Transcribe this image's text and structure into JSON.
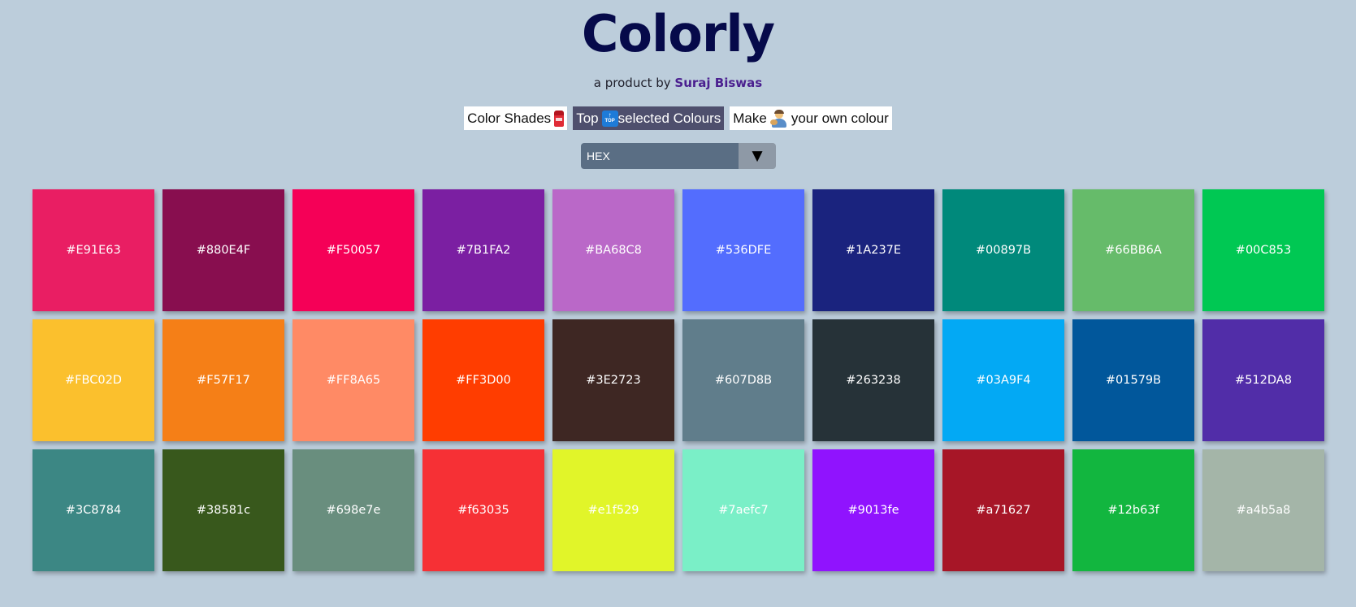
{
  "header": {
    "title": "Colorly",
    "byline_prefix": "a product by",
    "author": "Suraj Biswas"
  },
  "nav": {
    "items": [
      {
        "label": "Color Shades",
        "icon": "crayon-icon",
        "active": false
      },
      {
        "label_before": "Top",
        "icon": "top-icon",
        "label_after": "selected Colours",
        "active": true
      },
      {
        "label_before": "Make",
        "icon": "artist-icon",
        "label_after": "your own colour",
        "active": false
      }
    ]
  },
  "format_select": {
    "value": "HEX",
    "arrow": "▼"
  },
  "colors": {
    "accent": "#060a4a",
    "background": "#bccddb",
    "swatches": [
      "#E91E63",
      "#880E4F",
      "#F50057",
      "#7B1FA2",
      "#BA68C8",
      "#536DFE",
      "#1A237E",
      "#00897B",
      "#66BB6A",
      "#00C853",
      "#FBC02D",
      "#F57F17",
      "#FF8A65",
      "#FF3D00",
      "#3E2723",
      "#607D8B",
      "#263238",
      "#03A9F4",
      "#01579B",
      "#512DA8",
      "#3C8784",
      "#38581c",
      "#698e7e",
      "#f63035",
      "#e1f529",
      "#7aefc7",
      "#9013fe",
      "#a71627",
      "#12b63f",
      "#a4b5a8"
    ]
  }
}
